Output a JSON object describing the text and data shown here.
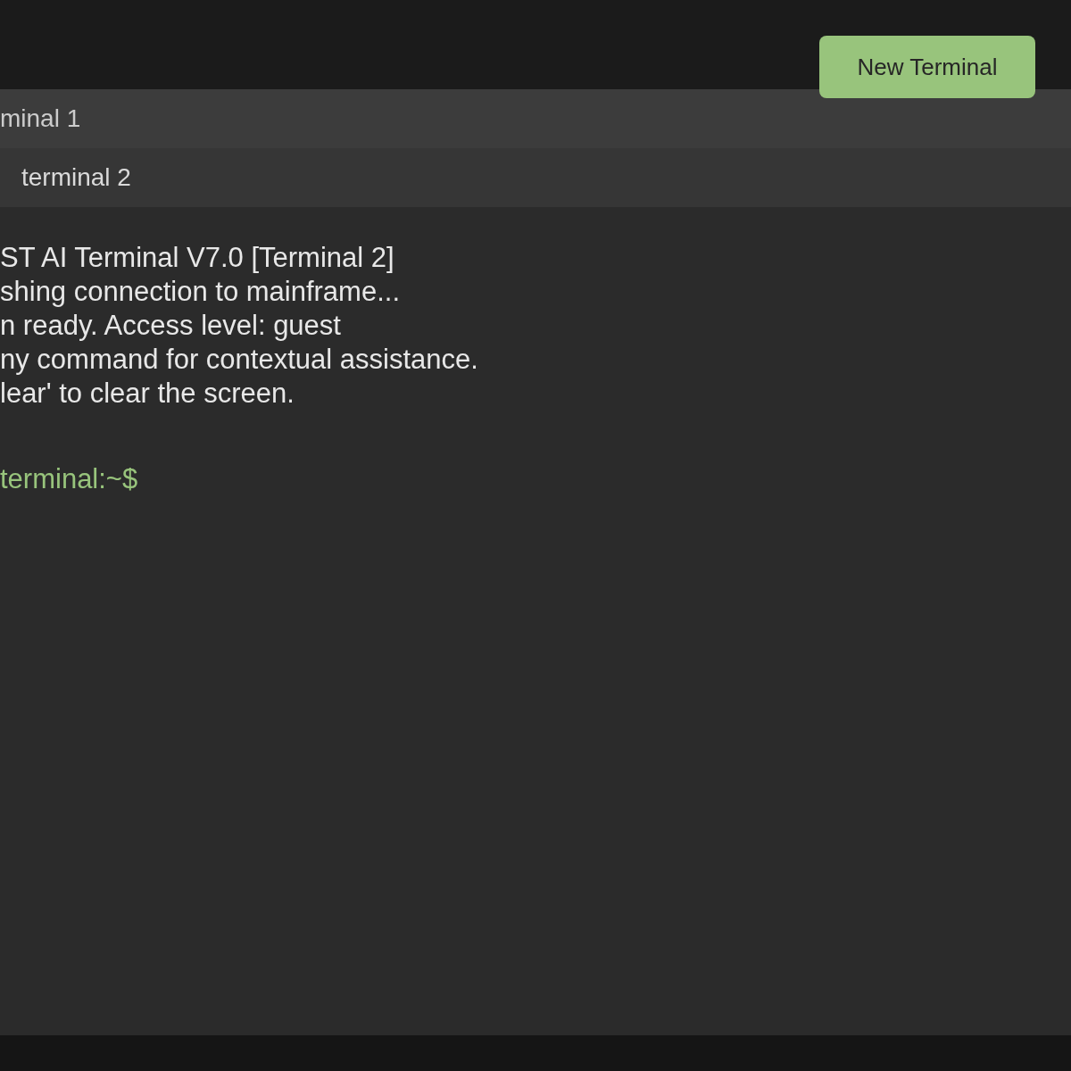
{
  "header": {
    "new_terminal_button": "New Terminal"
  },
  "tabs": [
    {
      "label": "minal 1",
      "selected": false
    },
    {
      "label": "terminal 2",
      "selected": true
    }
  ],
  "terminal": {
    "output_lines": [
      "ST AI Terminal V7.0 [Terminal 2]",
      "shing connection to mainframe...",
      "n ready. Access level: guest",
      "ny command for contextual assistance.",
      "lear' to clear the screen."
    ],
    "prompt": "terminal:~$"
  }
}
